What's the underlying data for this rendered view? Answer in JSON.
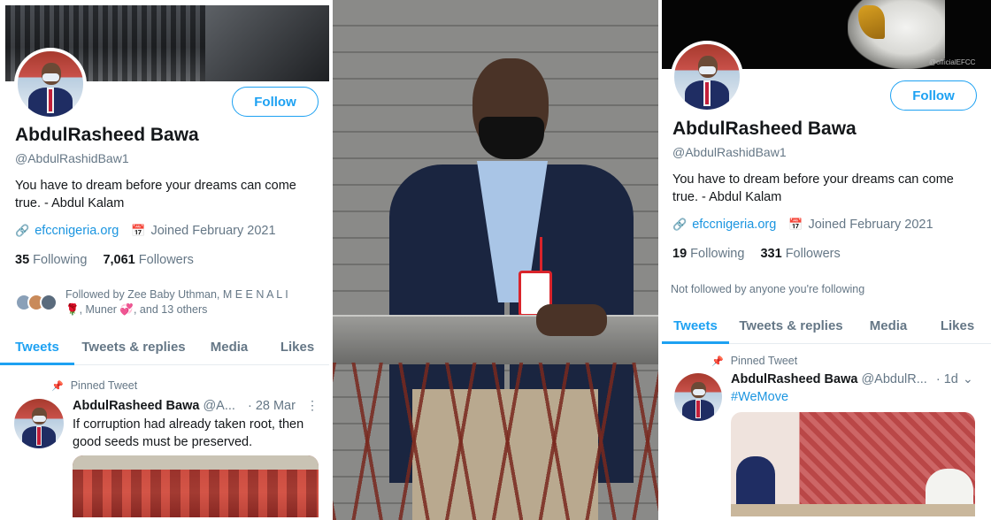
{
  "left": {
    "follow_label": "Follow",
    "name": "AbdulRasheed Bawa",
    "handle": "@AbdulRashidBaw1",
    "bio_line1": "You have to dream before your dreams can come",
    "bio_line2": "true.  - Abdul Kalam",
    "website": "efccnigeria.org",
    "joined": "Joined February 2021",
    "following_count": "35",
    "following_label": "Following",
    "followers_count": "7,061",
    "followers_label": "Followers",
    "followed_by_line1": "Followed by Zee Baby Uthman, M E E N A L I",
    "followed_by_line2": "🌹, Muner 💞, and 13 others",
    "tabs": [
      "Tweets",
      "Tweets & replies",
      "Media",
      "Likes"
    ],
    "pinned_label": "Pinned Tweet",
    "tweet": {
      "author": "AbdulRasheed Bawa",
      "handle": "@A...",
      "date": "· 28 Mar",
      "text_line1": "If corruption had already taken root, then",
      "text_line2": "good seeds must be preserved."
    }
  },
  "right": {
    "follow_label": "Follow",
    "name": "AbdulRasheed Bawa",
    "handle": "@AbdulRashidBaw1",
    "bio_line1": "You have to dream before your dreams can come",
    "bio_line2": "true.  - Abdul Kalam",
    "website": "efccnigeria.org",
    "joined": "Joined February 2021",
    "following_count": "19",
    "following_label": "Following",
    "followers_count": "331",
    "followers_label": "Followers",
    "not_followed": "Not followed by anyone you're following",
    "tabs": [
      "Tweets",
      "Tweets & replies",
      "Media",
      "Likes"
    ],
    "pinned_label": "Pinned Tweet",
    "tweet": {
      "author": "AbdulRasheed Bawa",
      "handle": "@AbdulR...",
      "date": "· 1d",
      "hashtag": "#WeMove"
    },
    "watermark": "@officialEFCC"
  },
  "icons": {
    "link": "link-icon",
    "calendar": "calendar-icon",
    "pin": "pin-icon",
    "more": "more-icon",
    "chevron": "chevron-down-icon"
  },
  "colors": {
    "accent": "#1da1f2",
    "link": "#1b95e0",
    "muted": "#657786",
    "text": "#14171a"
  }
}
